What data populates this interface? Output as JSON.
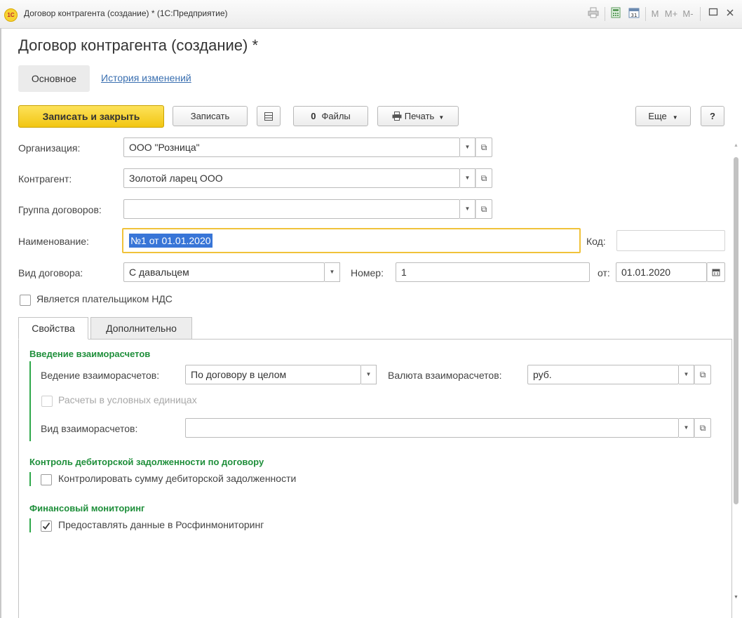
{
  "window": {
    "title": "Договор контрагента (создание) * (1С:Предприятие)",
    "logo_text": "1С",
    "toolbar_icons": [
      "print-icon",
      "calculator-icon",
      "calendar-icon"
    ],
    "toolbar_calendar_day": "31",
    "memory": {
      "m": "M",
      "m_plus": "M+",
      "m_minus": "M-"
    }
  },
  "form": {
    "title": "Договор контрагента (создание) *",
    "nav": {
      "main": "Основное",
      "history": "История изменений"
    },
    "buttons": {
      "save_close": "Записать и закрыть",
      "save": "Записать",
      "files": "Файлы",
      "print": "Печать",
      "more": "Еще",
      "help": "?"
    },
    "fields": {
      "org_label": "Организация:",
      "org_value": "ООО \"Розница\"",
      "counterparty_label": "Контрагент:",
      "counterparty_value": "Золотой ларец ООО",
      "group_label": "Группа договоров:",
      "group_value": "",
      "name_label": "Наименование:",
      "name_value": "№1 от 01.01.2020",
      "code_label": "Код:",
      "code_value": "",
      "type_label": "Вид договора:",
      "type_value": "С давальцем",
      "number_label": "Номер:",
      "number_value": "1",
      "date_label": "от:",
      "date_value": "01.01.2020",
      "vat_payer_label": "Является плательщиком НДС"
    },
    "tabs": {
      "props": "Свойства",
      "additional": "Дополнительно"
    },
    "settlements": {
      "title": "Введение взаиморасчетов",
      "mode_label": "Ведение взаиморасчетов:",
      "mode_value": "По договору в целом",
      "currency_label": "Валюта взаиморасчетов:",
      "currency_value": "руб.",
      "conv_units_label": "Расчеты в условных единицах",
      "kind_label": "Вид взаиморасчетов:",
      "kind_value": ""
    },
    "debt_control": {
      "title": "Контроль дебиторской задолженности по договору",
      "checkbox_label": "Контролировать сумму дебиторской задолженности",
      "checked": false
    },
    "fin_monitoring": {
      "title": "Финансовый мониторинг",
      "checkbox_label": "Предоставлять данные в Росфинмониторинг",
      "checked": true
    }
  }
}
